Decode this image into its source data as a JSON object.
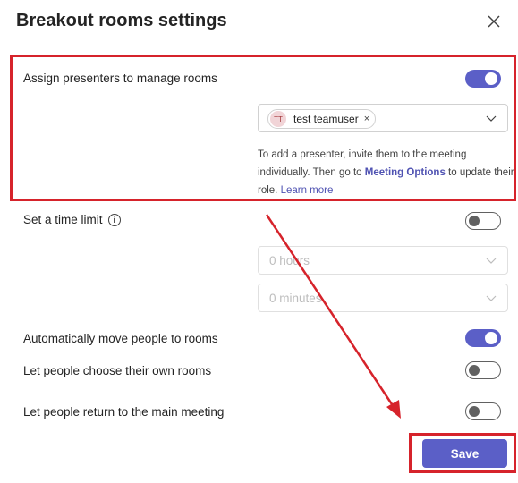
{
  "dialog": {
    "title": "Breakout rooms settings",
    "close_icon": "close-icon"
  },
  "presenters": {
    "label": "Assign presenters to manage rooms",
    "toggle_on": true,
    "chip": {
      "initials": "TT",
      "name": "test teamuser",
      "remove_icon": "×"
    },
    "help_prefix": "To add a presenter, invite them to the meeting individually. Then go to ",
    "help_bold": "Meeting Options",
    "help_suffix": " to update their role. ",
    "help_link": "Learn more"
  },
  "time_limit": {
    "label": "Set a time limit",
    "info_icon": "i",
    "toggle_on": false,
    "hours_placeholder": "0 hours",
    "minutes_placeholder": "0 minutes"
  },
  "options": [
    {
      "label": "Automatically move people to rooms",
      "toggle_on": true
    },
    {
      "label": "Let people choose their own rooms",
      "toggle_on": false
    },
    {
      "label": "Let people return to the main meeting",
      "toggle_on": false
    }
  ],
  "footer": {
    "save_label": "Save"
  },
  "colors": {
    "accent": "#5b5fc7",
    "annotation_red": "#d6232b"
  }
}
